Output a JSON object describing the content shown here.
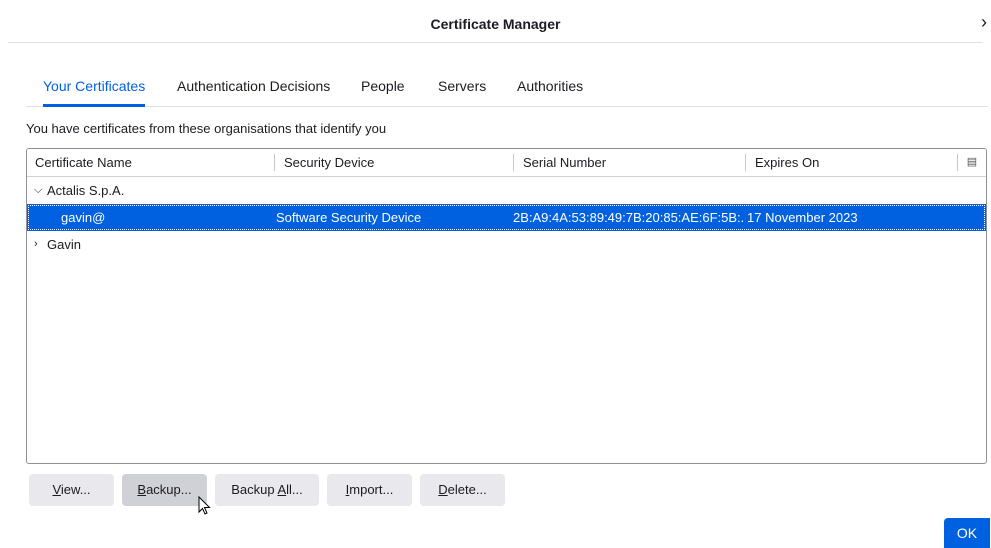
{
  "window": {
    "title": "Certificate Manager"
  },
  "tabs": [
    {
      "label": "Your Certificates",
      "active": true
    },
    {
      "label": "Authentication Decisions",
      "active": false
    },
    {
      "label": "People",
      "active": false
    },
    {
      "label": "Servers",
      "active": false
    },
    {
      "label": "Authorities",
      "active": false
    }
  ],
  "description": "You have certificates from these organisations that identify you",
  "table": {
    "columns": [
      "Certificate Name",
      "Security Device",
      "Serial Number",
      "Expires On"
    ],
    "groups": [
      {
        "name": "Actalis S.p.A.",
        "expanded": true,
        "rows": [
          {
            "name": "gavin@",
            "device": "Software Security Device",
            "serial": "2B:A9:4A:53:89:49:7B:20:85:AE:6F:5B:...",
            "expires": "17 November 2023",
            "selected": true
          }
        ]
      },
      {
        "name": "Gavin",
        "expanded": false,
        "rows": []
      }
    ]
  },
  "buttons": {
    "view": {
      "u": "V",
      "rest": "iew..."
    },
    "backup": {
      "u": "B",
      "rest": "ackup..."
    },
    "backup_all": {
      "pre": "Backup ",
      "u": "A",
      "rest": "ll..."
    },
    "import": {
      "u": "I",
      "rest": "mport..."
    },
    "delete": {
      "u": "D",
      "rest": "elete..."
    },
    "ok": "OK"
  },
  "icons": {
    "close": "close-icon",
    "column_picker": "column-picker-icon",
    "expand": "chevron-down-icon",
    "collapse": "chevron-right-icon"
  },
  "colors": {
    "accent": "#0061e0",
    "button_bg": "#e9e9ed",
    "text": "#1c1b22"
  }
}
